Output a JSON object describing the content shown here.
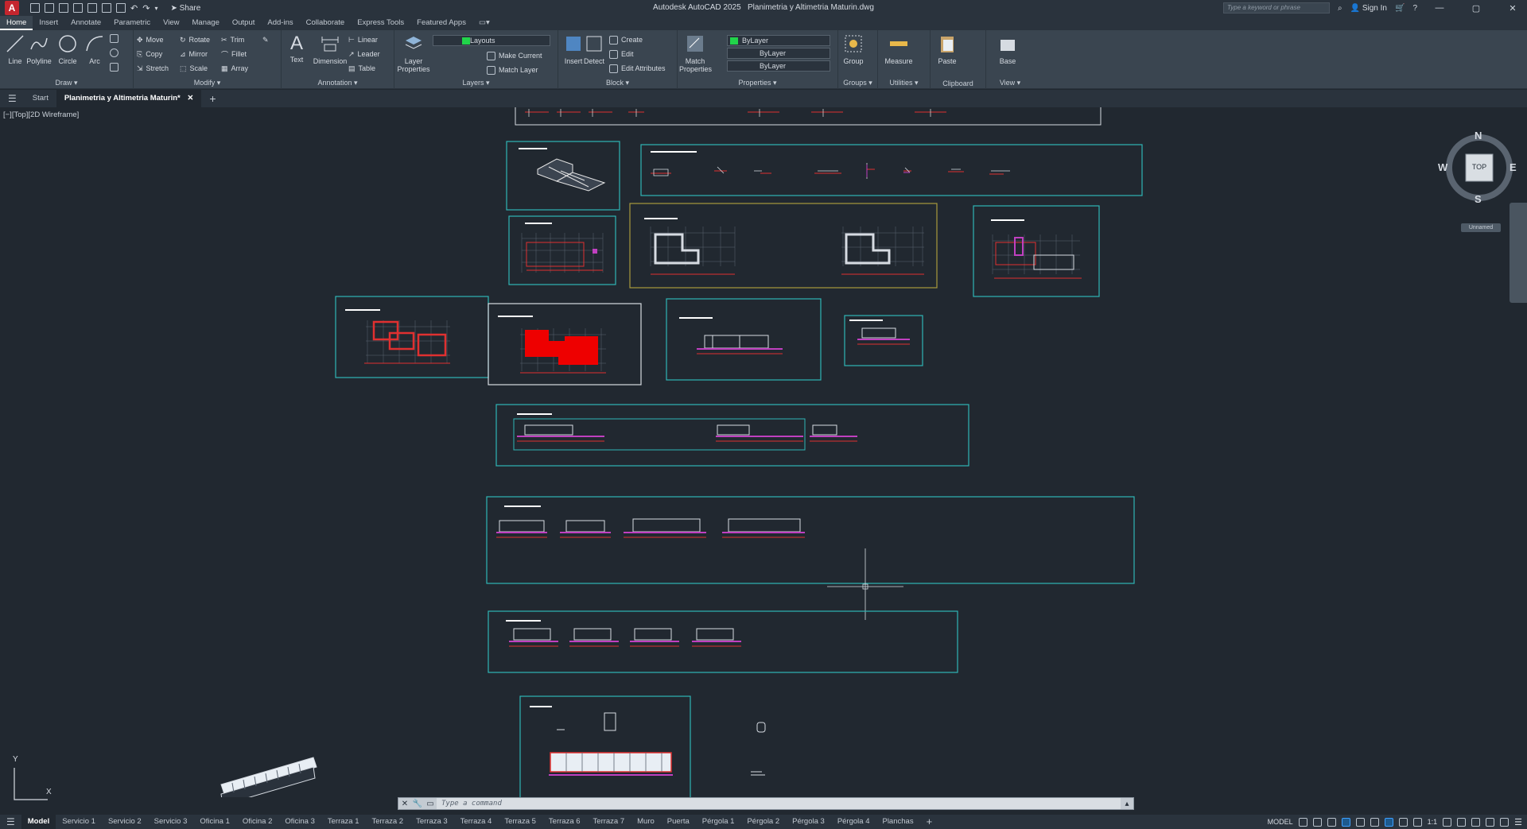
{
  "app": {
    "logo": "A",
    "title": "Autodesk AutoCAD 2025",
    "document": "Planimetria y Altimetria Maturin.dwg",
    "share_label": "Share",
    "search_placeholder": "Type a keyword or phrase",
    "sign_in": "Sign In",
    "window_controls": [
      "—",
      "▢",
      "✕"
    ]
  },
  "menu_tabs": [
    "Home",
    "Insert",
    "Annotate",
    "Parametric",
    "View",
    "Manage",
    "Output",
    "Add-ins",
    "Collaborate",
    "Express Tools",
    "Featured Apps"
  ],
  "ribbon": {
    "draw": {
      "title": "Draw ▾",
      "tools": [
        "Line",
        "Polyline",
        "Circle",
        "Arc"
      ]
    },
    "modify": {
      "title": "Modify ▾",
      "tools": [
        "Move",
        "Rotate",
        "Trim",
        "Copy",
        "Mirror",
        "Fillet",
        "Stretch",
        "Scale",
        "Array"
      ]
    },
    "annotation": {
      "title": "Annotation ▾",
      "tools": [
        "Text",
        "Dimension",
        "Linear",
        "Leader",
        "Table"
      ]
    },
    "layers": {
      "title": "Layers ▾",
      "tools": [
        "Layer Properties",
        "Make Current",
        "Match Layer"
      ],
      "current_layer": "Layouts"
    },
    "block": {
      "title": "Block ▾",
      "tools": [
        "Insert",
        "Detect",
        "Create",
        "Edit",
        "Edit Attributes"
      ]
    },
    "properties": {
      "title": "Properties ▾",
      "tools": [
        "Match Properties"
      ],
      "color": "ByLayer",
      "linetype": "ByLayer",
      "lineweight": "ByLayer"
    },
    "groups": {
      "title": "Groups ▾",
      "tools": [
        "Group"
      ]
    },
    "utilities": {
      "title": "Utilities ▾",
      "tools": [
        "Measure"
      ]
    },
    "clipboard": {
      "title": "Clipboard",
      "tools": [
        "Paste"
      ]
    },
    "view": {
      "title": "View ▾",
      "tools": [
        "Base"
      ]
    }
  },
  "doc_tabs": {
    "start": "Start",
    "active": "Planimetria y Altimetria Maturin*",
    "new": "+"
  },
  "viewport": {
    "label": "[−][Top][2D Wireframe]",
    "compass": {
      "n": "N",
      "s": "S",
      "e": "E",
      "w": "W",
      "top": "TOP"
    },
    "ucs_name": "Unnamed",
    "ucs_axes": {
      "x": "X",
      "y": "Y"
    }
  },
  "command": {
    "placeholder": "Type a command"
  },
  "layout_tabs": [
    "Model",
    "Servicio 1",
    "Servicio 2",
    "Servicio 3",
    "Oficina 1",
    "Oficina 2",
    "Oficina 3",
    "Terraza 1",
    "Terraza 2",
    "Terraza 3",
    "Terraza 4",
    "Terraza 5",
    "Terraza 6",
    "Terraza 7",
    "Muro",
    "Puerta",
    "Pérgola 1",
    "Pérgola 2",
    "Pérgola 3",
    "Pérgola 4",
    "Planchas"
  ],
  "status": {
    "mode": "MODEL",
    "scale": "1:1"
  },
  "colors": {
    "frame": "#2fb6b6",
    "layer_swatch": "#21d44a",
    "drawing_red": "#e02020",
    "drawing_magenta": "#c040c0",
    "background": "#212830"
  }
}
